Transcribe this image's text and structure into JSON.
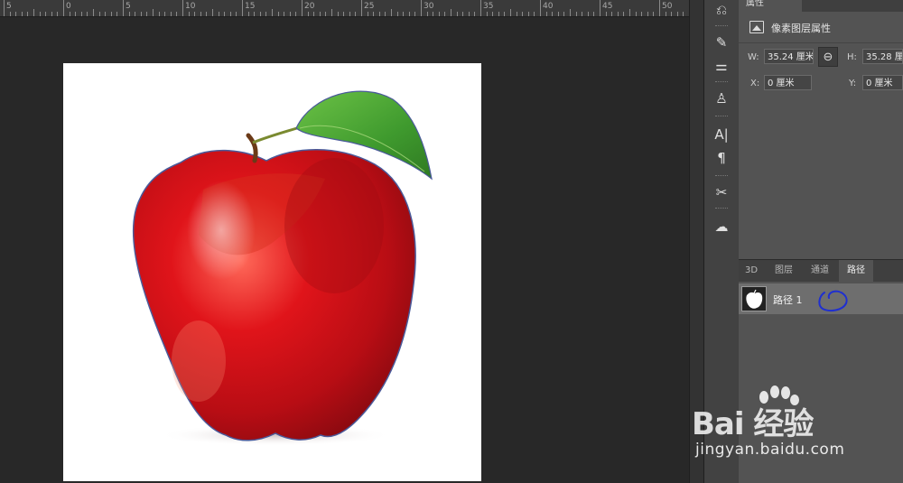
{
  "ruler": {
    "labels": [
      "5",
      "0",
      "5",
      "10",
      "15",
      "20",
      "25",
      "30",
      "35",
      "40",
      "45",
      "50"
    ]
  },
  "canvas": {
    "image_subject": "red-apple-with-leaf",
    "path_outline_color": "#4a5a9a"
  },
  "toolstrip": {
    "icons": [
      "history-icon",
      "brush-settings-icon",
      "adjustments-icon",
      "clone-source-icon",
      "character-icon",
      "paragraph-icon",
      "tool-presets-icon",
      "libraries-icon"
    ]
  },
  "properties": {
    "tab_label": "属性",
    "section_title": "像素图层属性",
    "w_label": "W:",
    "w_value": "35.24 厘米",
    "h_label": "H:",
    "h_value": "35.28 厘米",
    "x_label": "X:",
    "x_value": "0 厘米",
    "y_label": "Y:",
    "y_value": "0 厘米"
  },
  "paths_panel": {
    "tabs": [
      "3D",
      "图层",
      "通道",
      "路径"
    ],
    "active_tab": "路径",
    "path_item": "路径 1",
    "annotation_color": "#1f2fd0"
  },
  "watermark": {
    "brand": "Bai 经验",
    "url": "jingyan.baidu.com"
  }
}
